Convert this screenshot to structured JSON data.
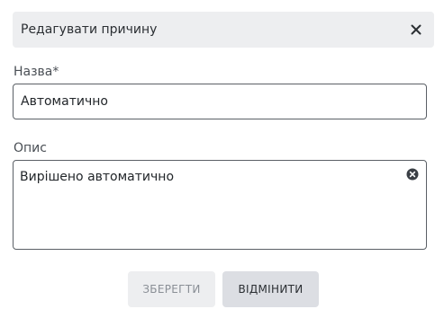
{
  "dialog": {
    "title": "Редагувати причину",
    "close_icon": "close-icon"
  },
  "fields": {
    "name": {
      "label": "Назва*",
      "value": "Автоматично"
    },
    "description": {
      "label": "Опис",
      "value": "Вирішено автоматично",
      "clear_icon": "clear-circle-icon"
    }
  },
  "actions": {
    "save_label": "ЗБЕРЕГТИ",
    "cancel_label": "ВІДМІНИТИ"
  }
}
